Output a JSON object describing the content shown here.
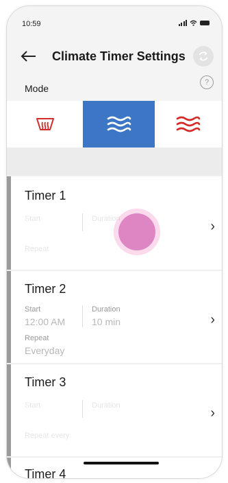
{
  "status": {
    "time": "10:59"
  },
  "header": {
    "title": "Climate Timer Settings"
  },
  "mode": {
    "label": "Mode",
    "help_glyph": "?"
  },
  "mode_buttons": [
    {
      "name": "defrost",
      "icon": "defrost-icon",
      "color": "#d32a2a",
      "selected": false
    },
    {
      "name": "ventilation",
      "icon": "air-flow-icon",
      "color": "#ffffff",
      "selected": true
    },
    {
      "name": "heat",
      "icon": "heat-waves-icon",
      "color": "#d32a2a",
      "selected": false
    }
  ],
  "accent": "#3c76c4",
  "timers": [
    {
      "title": "Timer 1",
      "start_label": "Start",
      "duration_label": "Duration",
      "repeat_label": "Repeat",
      "start": "",
      "duration": "",
      "repeat": ""
    },
    {
      "title": "Timer 2",
      "start_label": "Start",
      "duration_label": "Duration",
      "repeat_label": "Repeat",
      "start": "12:00 AM",
      "duration": "10 min",
      "repeat": "Everyday"
    },
    {
      "title": "Timer 3",
      "start_label": "Start",
      "duration_label": "Duration",
      "repeat_label": "Repeat every",
      "start": "",
      "duration": "",
      "repeat": ""
    },
    {
      "title": "Timer 4"
    }
  ],
  "chevron": "›"
}
